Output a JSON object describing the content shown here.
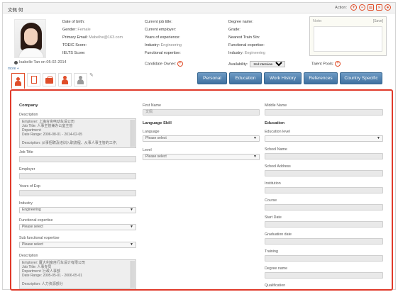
{
  "window": {
    "title": "文佩 何",
    "action_label": "Action:",
    "action_icons": [
      "add-icon",
      "remove-icon",
      "print-icon",
      "delete-icon",
      "user-icon"
    ]
  },
  "profile": {
    "posted": "Isabelle Tan on 05-02-2014",
    "more": "more +"
  },
  "info_col1": [
    {
      "key": "Date of birth:",
      "value": ""
    },
    {
      "key": "Gender:",
      "value": "Female"
    },
    {
      "key": "Primary Email:",
      "value": "Mabelhe@163.com"
    },
    {
      "key": "TOEIC Score:",
      "value": ""
    },
    {
      "key": "IELTS Score:",
      "value": ""
    }
  ],
  "info_col2": [
    {
      "key": "Current job title:",
      "value": ""
    },
    {
      "key": "Current employer:",
      "value": ""
    },
    {
      "key": "Years of experience:",
      "value": ""
    },
    {
      "key": "Industry:",
      "value": "Engineering"
    },
    {
      "key": "Functional expertise:",
      "value": ""
    }
  ],
  "info_col3": [
    {
      "key": "Degree name:",
      "value": ""
    },
    {
      "key": "Grade:",
      "value": ""
    },
    {
      "key": "Nearest Train Stn:",
      "value": ""
    },
    {
      "key": "Functional expertise:",
      "value": ""
    },
    {
      "key": "Industry:",
      "value": "Engineering"
    }
  ],
  "note": {
    "label": "Note:",
    "save": "[Save]"
  },
  "candidate_owner": "Candidate Owner:",
  "availability": {
    "label": "Availability:",
    "value": "2nd Interview"
  },
  "talent_pools": "Talent Pools:",
  "section_tabs": [
    "Personal",
    "Education",
    "Work History",
    "References",
    "Country Specific"
  ],
  "left": {
    "heading": "Company",
    "description_label": "Description",
    "description1": "Employer: 上海合资电动车设公司\nJob Title: 人事主管兼办公室主管\nDepartment:\nDate Range: 2006-08-01 - 2014-02-05\n\nDescription: 从事招聘及培训入职流程、从事人事主管的工作,",
    "job_title_label": "Job Title",
    "employer_label": "Employer",
    "years_label": "Years of Exp",
    "industry_label": "Industry",
    "industry_value": "Engineering",
    "func_label": "Functional expertise",
    "func_value": "Please select",
    "subfunc_label": "Sub functional expertise",
    "subfunc_value": "Please select",
    "description2": "Employer: 厦大利富自行车设计有限公司\nJob Title: 人事专员\nDepartment: 行政人事部\nDate Range: 2005-05-01 - 2006-05-01\n\nDescription: 人力资源部分"
  },
  "middle": {
    "first_name_label": "First Name",
    "first_name_value": "文佩",
    "language_heading": "Language Skill",
    "language_label": "Language",
    "language_value": "Please select",
    "level_label": "Level",
    "level_value": "Please select"
  },
  "right": {
    "middle_name_label": "Middle Name",
    "education_heading": "Education",
    "education_level_label": "Education level",
    "school_name_label": "School Name",
    "school_address_label": "School Address",
    "institution_label": "Institution",
    "course_label": "Course",
    "start_date_label": "Start Date",
    "graduation_label": "Graduation date",
    "training_label": "Training",
    "degree_label": "Degree name",
    "qualification_label": "Qualification"
  },
  "colors": {
    "accent": "#e04e2a",
    "tab_blue": "#4a7aa8",
    "frame_red": "#e03a2a"
  }
}
